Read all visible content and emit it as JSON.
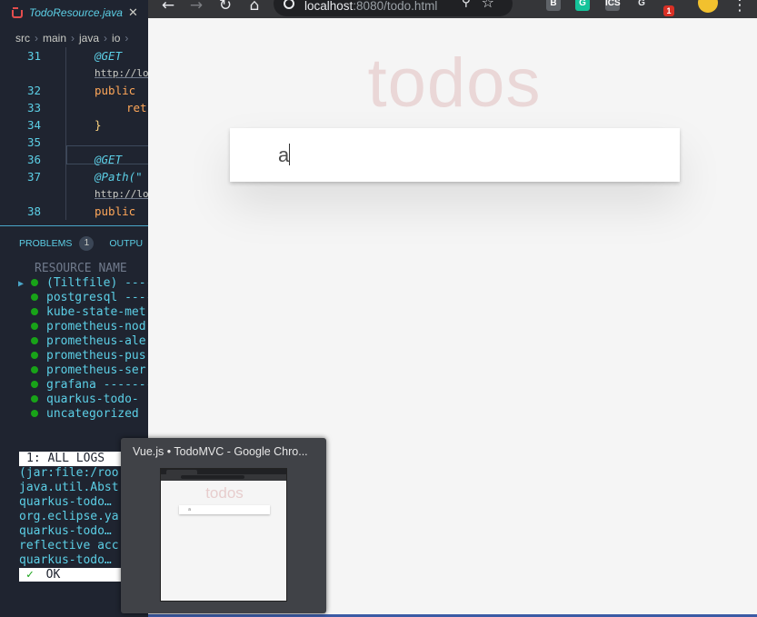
{
  "editor": {
    "tab_label": "TodoResource.java",
    "tab_close": "✕",
    "breadcrumb": [
      "src",
      "main",
      "java",
      "io"
    ],
    "breadcrumb_sep": "›",
    "code_lines": [
      {
        "num": "31",
        "text": "@GET",
        "kind": "anno"
      },
      {
        "num": "",
        "text": "http://loc",
        "kind": "link"
      },
      {
        "num": "32",
        "text": "public",
        "kind": "kw"
      },
      {
        "num": "33",
        "text": "ret",
        "kind": "kw"
      },
      {
        "num": "34",
        "text": "}",
        "kind": "bracket"
      },
      {
        "num": "35",
        "text": "",
        "kind": "plain"
      },
      {
        "num": "36",
        "text": "@GET",
        "kind": "anno"
      },
      {
        "num": "37",
        "text": "@Path(\"",
        "kind": "anno"
      },
      {
        "num": "",
        "text": "http://loc",
        "kind": "link"
      },
      {
        "num": "38",
        "text": "public",
        "kind": "kw"
      }
    ]
  },
  "panel": {
    "problems_label": "PROBLEMS",
    "problems_count": "1",
    "output_label": "OUTPU"
  },
  "terminal": {
    "header": "RESOURCE NAME",
    "resources": [
      {
        "name": "(Tiltfile) -----",
        "selected": true
      },
      {
        "name": "postgresql -----",
        "selected": false
      },
      {
        "name": "kube-state-met",
        "selected": false
      },
      {
        "name": "prometheus-nod",
        "selected": false
      },
      {
        "name": "prometheus-ale",
        "selected": false
      },
      {
        "name": "prometheus-pus",
        "selected": false
      },
      {
        "name": "prometheus-ser",
        "selected": false
      },
      {
        "name": "grafana -------",
        "selected": false
      },
      {
        "name": "quarkus-todo-",
        "selected": false
      },
      {
        "name": "uncategorized",
        "selected": false
      }
    ],
    "logs_tab": "1: ALL LOGS",
    "log_lines": [
      "(jar:file:/roo",
      "java.util.Abst",
      "quarkus-todo…",
      "org.eclipse.ya",
      "quarkus-todo…",
      "reflective acc",
      "quarkus-todo…"
    ],
    "status_check": "✓",
    "status_text": "OK",
    "colors": {
      "ok_dot": "#18a318",
      "text": "#5ccfe6"
    }
  },
  "browser": {
    "url_host": "localhost",
    "url_path": ":8080/todo.html",
    "extensions": [
      {
        "label": "B",
        "bg": "#5f6368",
        "fg": "#ffffff"
      },
      {
        "label": "G",
        "bg": "#15c39a",
        "fg": "#ffffff"
      },
      {
        "label": "ICS",
        "bg": "#5f6368",
        "fg": "#ffffff"
      },
      {
        "label": "G",
        "bg": "#353639",
        "fg": "#e8eaed"
      },
      {
        "label": "1",
        "bg": "#d93025",
        "fg": "#ffffff"
      }
    ],
    "page": {
      "title": "todos",
      "new_todo_value": "a"
    }
  },
  "taskbar_preview": {
    "title": "Vue.js • TodoMVC - Google Chro...",
    "thumb_title": "todos",
    "thumb_input": "a"
  }
}
